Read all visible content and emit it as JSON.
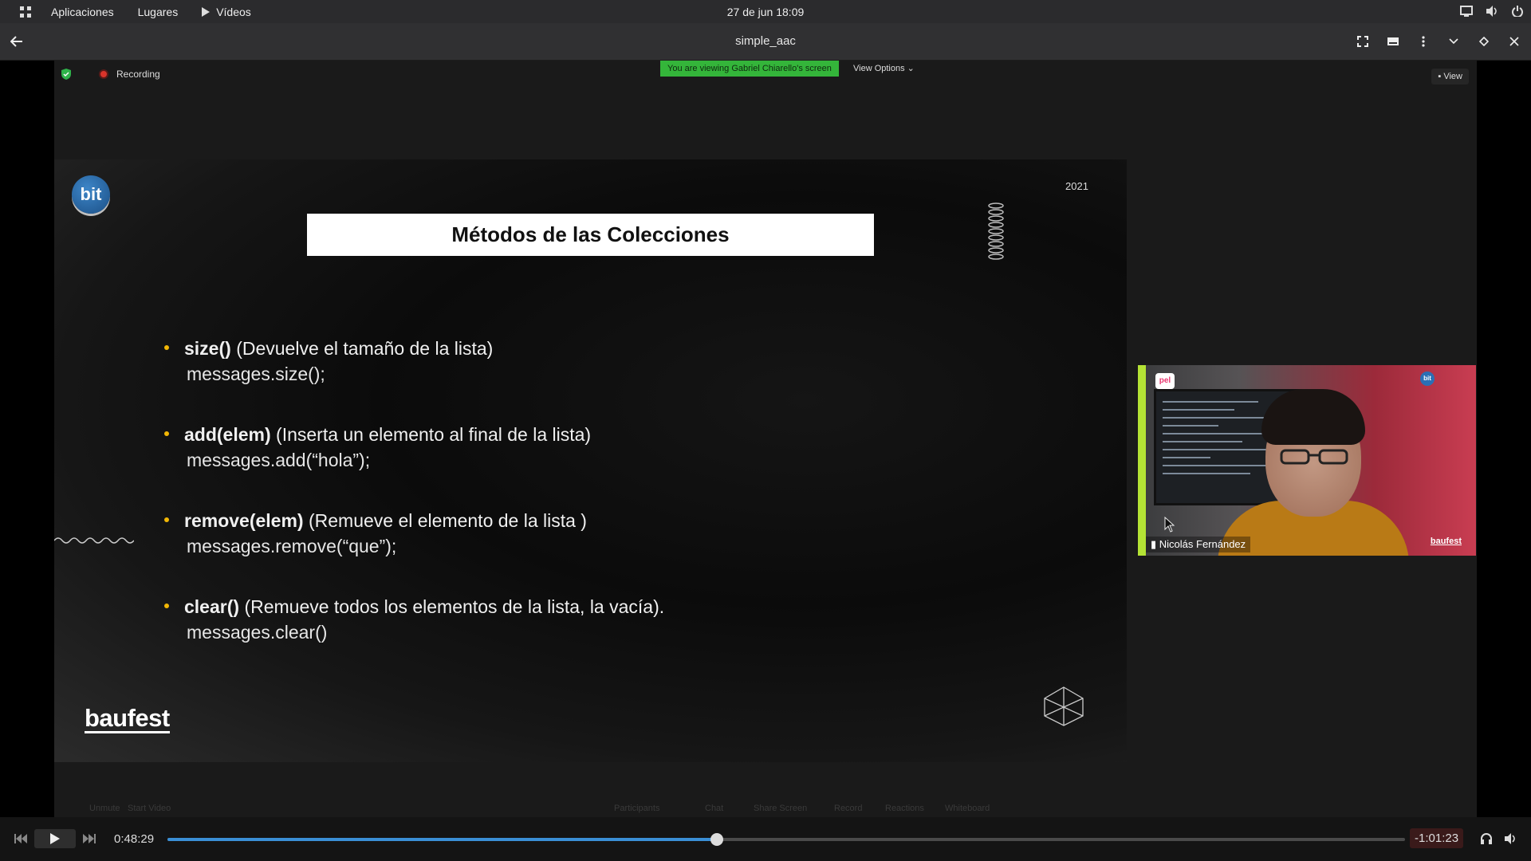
{
  "topbar": {
    "apps_label": "Aplicaciones",
    "places_label": "Lugares",
    "videos_label": "Vídeos",
    "clock": "27 de jun  18:09"
  },
  "window": {
    "title": "simple_aac"
  },
  "zoom": {
    "recording_label": "Recording",
    "viewing_notice": "You are viewing Gabriel Chiarello's screen",
    "view_options_label": "View Options",
    "view_label": "View",
    "toolbar_items": [
      "Unmute",
      "Start Video",
      "Participants",
      "Chat",
      "Share Screen",
      "Record",
      "Reactions",
      "Whiteboard"
    ]
  },
  "slide": {
    "logo_text": "bit",
    "year": "2021",
    "title": "Métodos de las Colecciones",
    "methods": [
      {
        "name": "size()",
        "desc": "(Devuelve el tamaño de la lista)",
        "code": "messages.size();"
      },
      {
        "name": "add(elem)",
        "desc": "(Inserta un elemento al final de la lista)",
        "code": "messages.add(“hola”);"
      },
      {
        "name": "remove(elem)",
        "desc": "(Remueve el elemento de la lista )",
        "code": "messages.remove(“que”);"
      },
      {
        "name": "clear()",
        "desc": "(Remueve todos los elementos de la lista, la vacía).",
        "code": "messages.clear()"
      }
    ],
    "brand": "baufest"
  },
  "speaker": {
    "name": "Nicolás Fernández",
    "pel_label": "pel",
    "bit_label": "bit",
    "brand": "baufest"
  },
  "player": {
    "elapsed": "0:48:29",
    "remaining": "-1:01:23",
    "progress_fraction": 0.444
  },
  "colors": {
    "accent": "#3a8fd6",
    "viewing_green": "#34b53a",
    "bullet": "#f2b705"
  }
}
